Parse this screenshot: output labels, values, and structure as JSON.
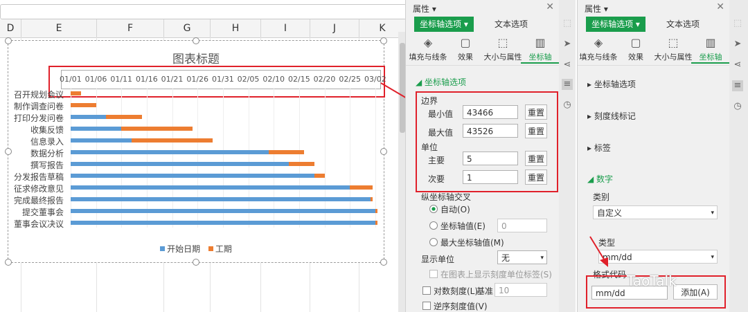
{
  "sheet": {
    "columns": [
      "D",
      "E",
      "F",
      "G",
      "H",
      "I",
      "J",
      "K"
    ]
  },
  "chart_data": {
    "type": "bar",
    "orientation": "horizontal-stacked",
    "title": "图表标题",
    "x_axis_ticks": [
      "01/01",
      "01/06",
      "01/11",
      "01/16",
      "01/21",
      "01/26",
      "01/31",
      "02/05",
      "02/10",
      "02/15",
      "02/20",
      "02/25",
      "03/02"
    ],
    "categories": [
      "召开规划会议",
      "制作调查问卷",
      "打印分发问卷",
      "收集反馈",
      "信息录入",
      "数据分析",
      "撰写报告",
      "分发报告草稿",
      "征求修改意见",
      "完成最终报告",
      "提交董事会",
      "董事会议决议"
    ],
    "series": [
      {
        "name": "开始日期",
        "values": [
          "01/01",
          "01/01",
          "01/08",
          "01/11",
          "01/13",
          "02/09",
          "02/13",
          "02/18",
          "02/25",
          "03/01",
          "03/09",
          "03/10"
        ],
        "color": "#5b9bd5"
      },
      {
        "name": "工期",
        "values": [
          2,
          5,
          7,
          14,
          16,
          7,
          5,
          2,
          10,
          8,
          1,
          3
        ],
        "color": "#ed7d31"
      }
    ],
    "xlim": [
      43466,
      43526
    ],
    "legend": "bottom"
  },
  "pane1": {
    "title": "属性",
    "tab_active": "坐标轴选项",
    "tab_other": "文本选项",
    "icons": [
      "填充与线条",
      "效果",
      "大小与属性",
      "坐标轴"
    ],
    "section": "坐标轴选项",
    "bounds_label": "边界",
    "min_label": "最小值",
    "min_value": "43466",
    "max_label": "最大值",
    "max_value": "43526",
    "reset": "重置",
    "unit_label": "单位",
    "major_label": "主要",
    "major_value": "5",
    "minor_label": "次要",
    "minor_value": "1",
    "cross_label": "纵坐标轴交叉",
    "auto_label": "自动(O)",
    "axis_value_label": "坐标轴值(E)",
    "axis_value_input": "0",
    "max_axis_label": "最大坐标轴值(M)",
    "display_unit_label": "显示单位",
    "display_unit_value": "无",
    "show_unit_label": "在图表上显示刻度单位标签(S)",
    "log_scale_label": "对数刻度(L)",
    "base_label": "基准",
    "base_value": "10",
    "reverse_label": "逆序刻度值(V)"
  },
  "pane2": {
    "title": "属性",
    "tab_active": "坐标轴选项",
    "tab_other": "文本选项",
    "icons": [
      "填充与线条",
      "效果",
      "大小与属性",
      "坐标轴"
    ],
    "sections": [
      "坐标轴选项",
      "刻度线标记",
      "标签"
    ],
    "number_section": "数字",
    "category_label": "类别",
    "category_value": "自定义",
    "type_label": "类型",
    "type_value": "mm/dd",
    "format_code_label": "格式代码",
    "format_code_value": "mm/dd",
    "add_button": "添加(A)"
  },
  "watermark": "TaoTalk",
  "colors": {
    "accent": "#1a9d4c",
    "highlight": "#e0202a",
    "start": "#5b9bd5",
    "duration": "#ed7d31"
  }
}
